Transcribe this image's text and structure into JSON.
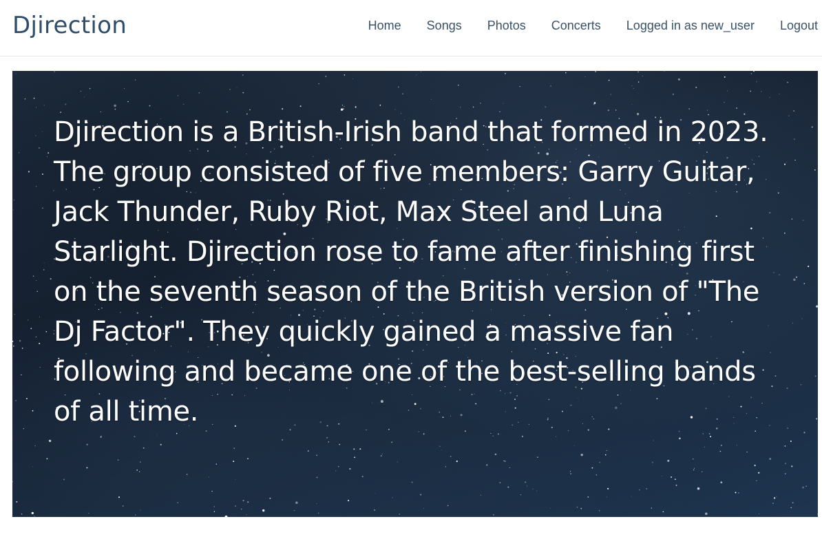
{
  "brand": {
    "name": "Djirection"
  },
  "nav": {
    "items": [
      {
        "label": "Home"
      },
      {
        "label": "Songs"
      },
      {
        "label": "Photos"
      },
      {
        "label": "Concerts"
      },
      {
        "label": "Logged in as new_user"
      },
      {
        "label": "Logout"
      }
    ]
  },
  "hero": {
    "text": "Djirection is a British-Irish band that formed in 2023. The group consisted of five members: Garry Guitar, Jack Thunder, Ruby Riot, Max Steel and Luna Starlight. Djirection rose to fame after finishing first on the seventh season of the British version of \"The Dj Factor\". They quickly gained a massive fan following and became one of the best-selling bands of all time."
  },
  "colors": {
    "brand": "#2e4d6b",
    "nav_link": "#3a5168",
    "hero_text": "#ffffff",
    "hero_background": "#15202e"
  }
}
